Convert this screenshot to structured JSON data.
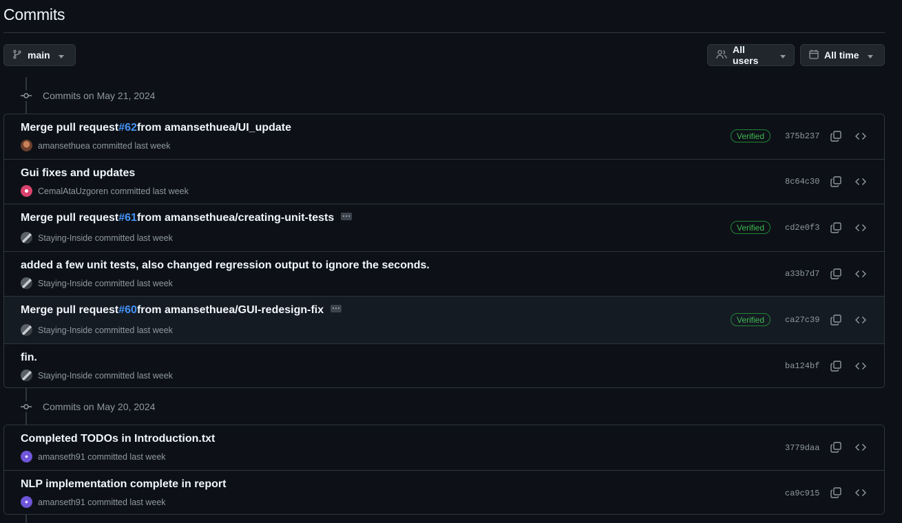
{
  "page": {
    "title": "Commits"
  },
  "toolbar": {
    "branch_label": "main",
    "users_label": "All users",
    "time_label": "All time"
  },
  "groups": [
    {
      "heading": "Commits on May 21, 2024",
      "commits": [
        {
          "message_prefix": "Merge pull request ",
          "pr": "#62",
          "message_suffix": " from amansethuea/UI_update",
          "author": "amansethuea",
          "meta": " committed last week",
          "verified": "Verified",
          "sha": "375b237",
          "avatar": "brown"
        },
        {
          "message_prefix": "Gui fixes and updates",
          "author": "CemalAtaUzgoren",
          "meta": " committed last week",
          "sha": "8c64c30",
          "avatar": "red"
        },
        {
          "message_prefix": "Merge pull request ",
          "pr": "#61",
          "message_suffix": " from amansethuea/creating-unit-tests",
          "author": "Staying-Inside",
          "meta": " committed last week",
          "verified": "Verified",
          "sha": "cd2e0f3",
          "avatar": "gray",
          "has_ellipsis": true
        },
        {
          "message_prefix": "added a few unit tests, also changed regression output to ignore the seconds.",
          "author": "Staying-Inside",
          "meta": " committed last week",
          "sha": "a33b7d7",
          "avatar": "gray"
        },
        {
          "message_prefix": "Merge pull request ",
          "pr": "#60",
          "message_suffix": " from amansethuea/GUI-redesign-fix",
          "author": "Staying-Inside",
          "meta": " committed last week",
          "verified": "Verified",
          "sha": "ca27c39",
          "avatar": "gray",
          "has_ellipsis": true,
          "highlighted": true
        },
        {
          "message_prefix": "fin.",
          "author": "Staying-Inside",
          "meta": " committed last week",
          "sha": "ba124bf",
          "avatar": "gray"
        }
      ]
    },
    {
      "heading": "Commits on May 20, 2024",
      "commits": [
        {
          "message_prefix": "Completed TODOs in Introduction.txt",
          "author": "amanseth91",
          "meta": " committed last week",
          "sha": "3779daa",
          "avatar": "purple"
        },
        {
          "message_prefix": "NLP implementation complete in report",
          "author": "amanseth91",
          "meta": " committed last week",
          "sha": "ca9c915",
          "avatar": "purple"
        }
      ]
    }
  ],
  "icons": {
    "branch": "git-branch-icon",
    "users": "people-icon",
    "calendar": "calendar-icon",
    "caret": "triangle-down-icon",
    "commit_node": "git-commit-icon",
    "copy": "copy-icon",
    "browse": "code-icon"
  },
  "colors": {
    "background": "#0d1117",
    "border": "#30363d",
    "link": "#4493f8",
    "verified": "#3fb950",
    "muted": "#9198a1"
  }
}
